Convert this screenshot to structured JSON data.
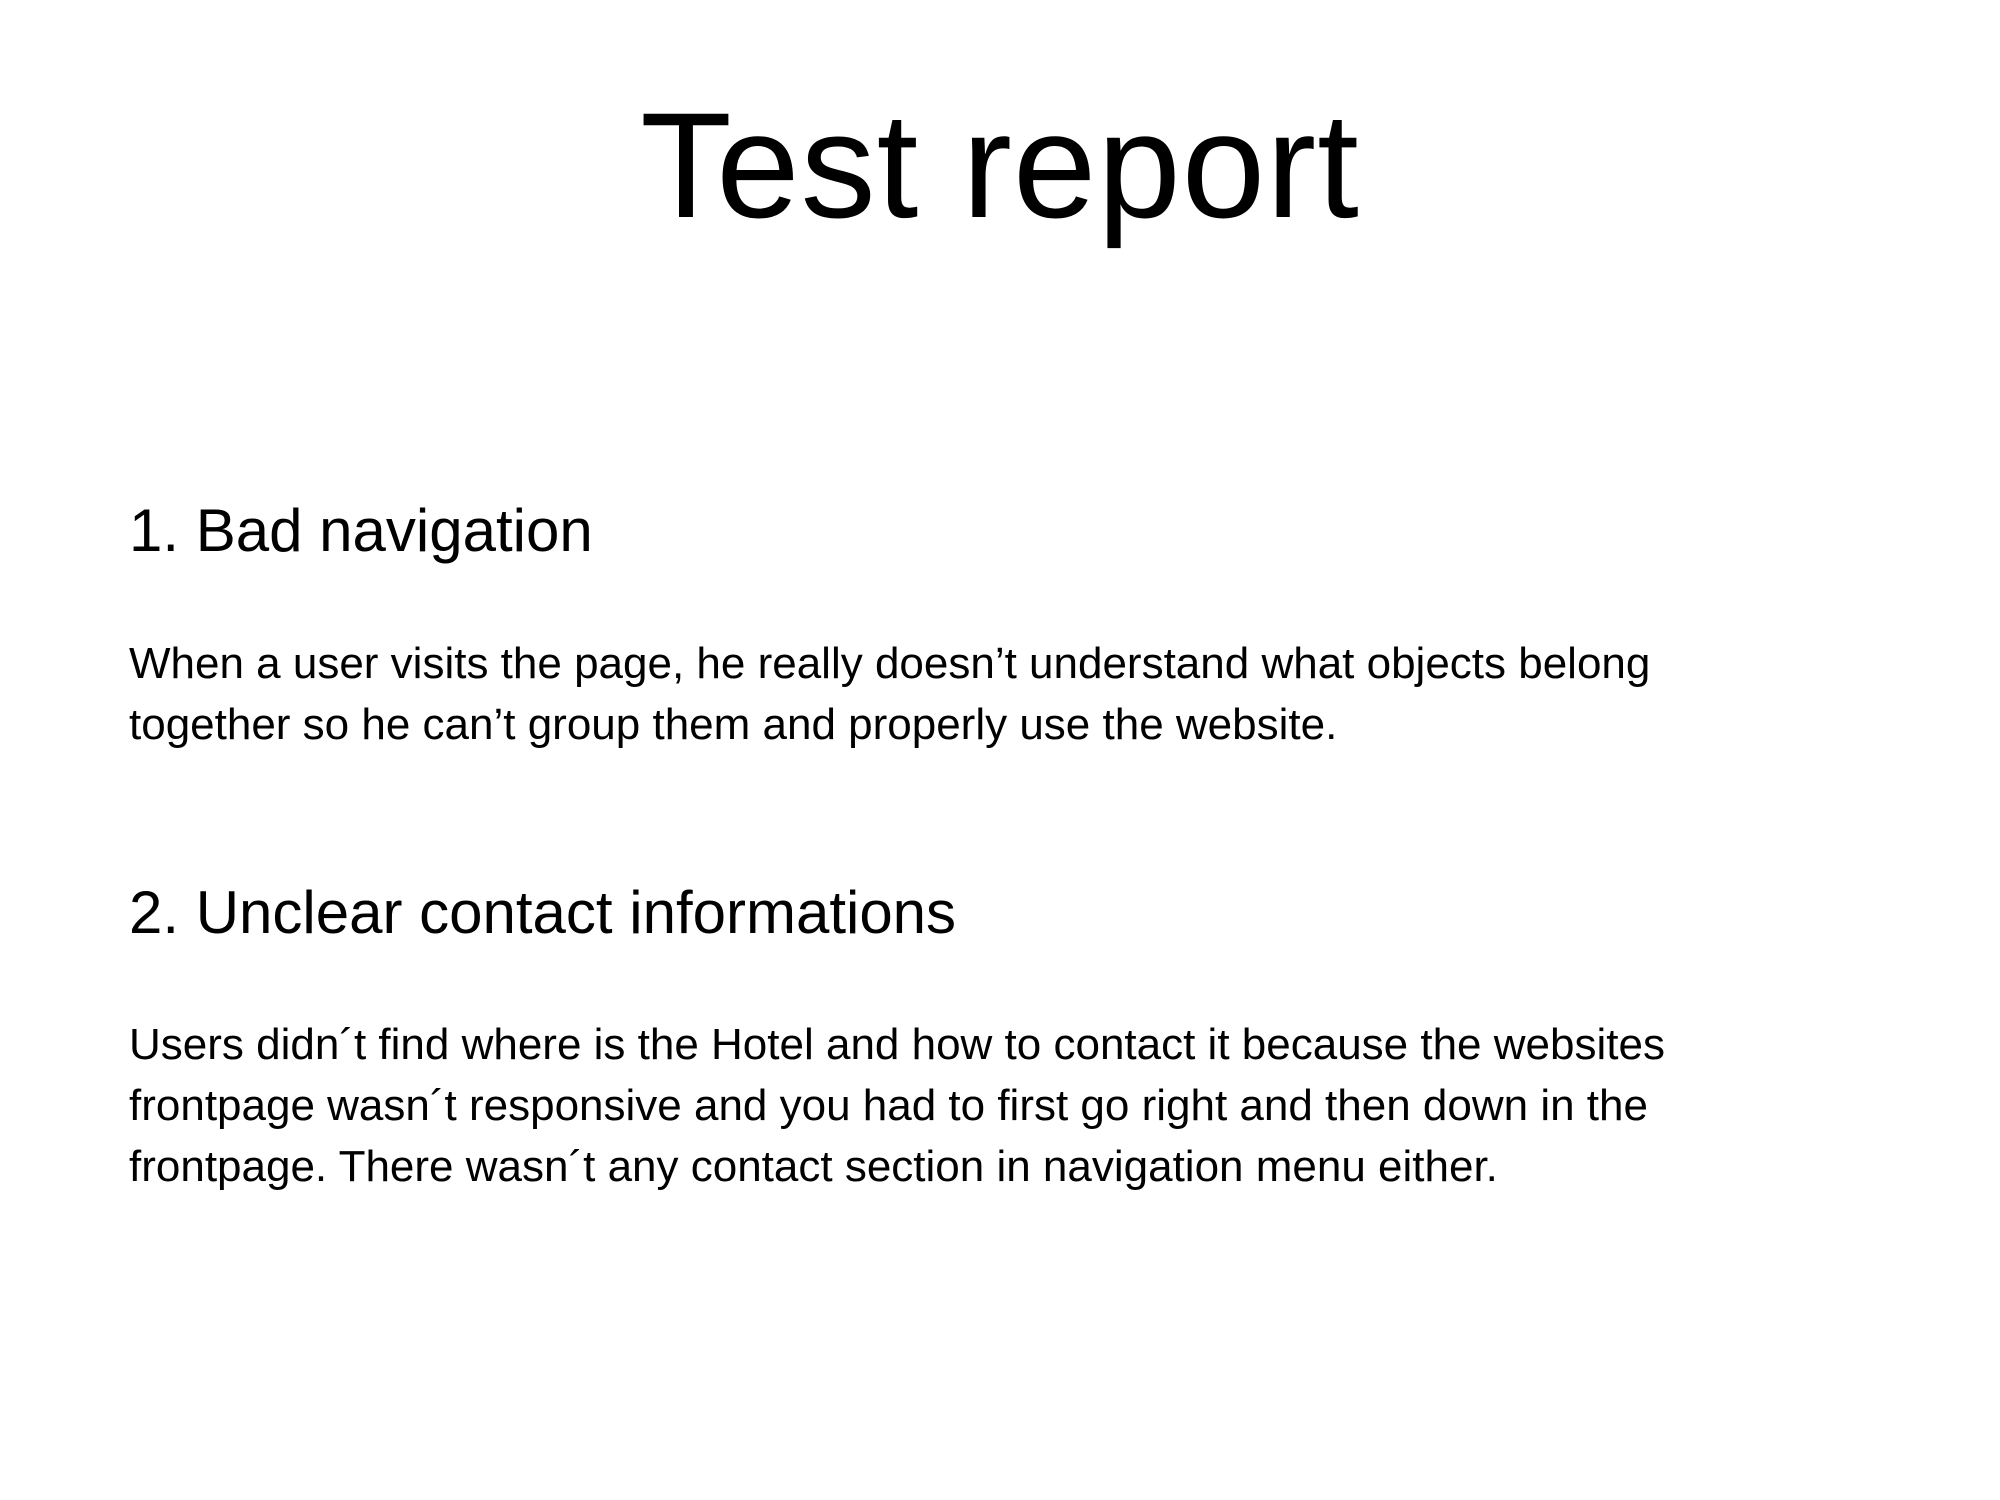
{
  "title": "Test report",
  "sections": [
    {
      "heading": "1. Bad navigation",
      "lines": [
        "When a user visits the page, he really doesn’t understand what objects belong",
        "together so he can’t group them and properly use the website."
      ]
    },
    {
      "heading": "2. Unclear contact informations",
      "lines": [
        "Users didn´t find where is the Hotel and how to contact it because the websites",
        "frontpage wasn´t responsive and you had to first go right and then down in the",
        "frontpage. There wasn´t any contact section in navigation menu either."
      ]
    }
  ]
}
